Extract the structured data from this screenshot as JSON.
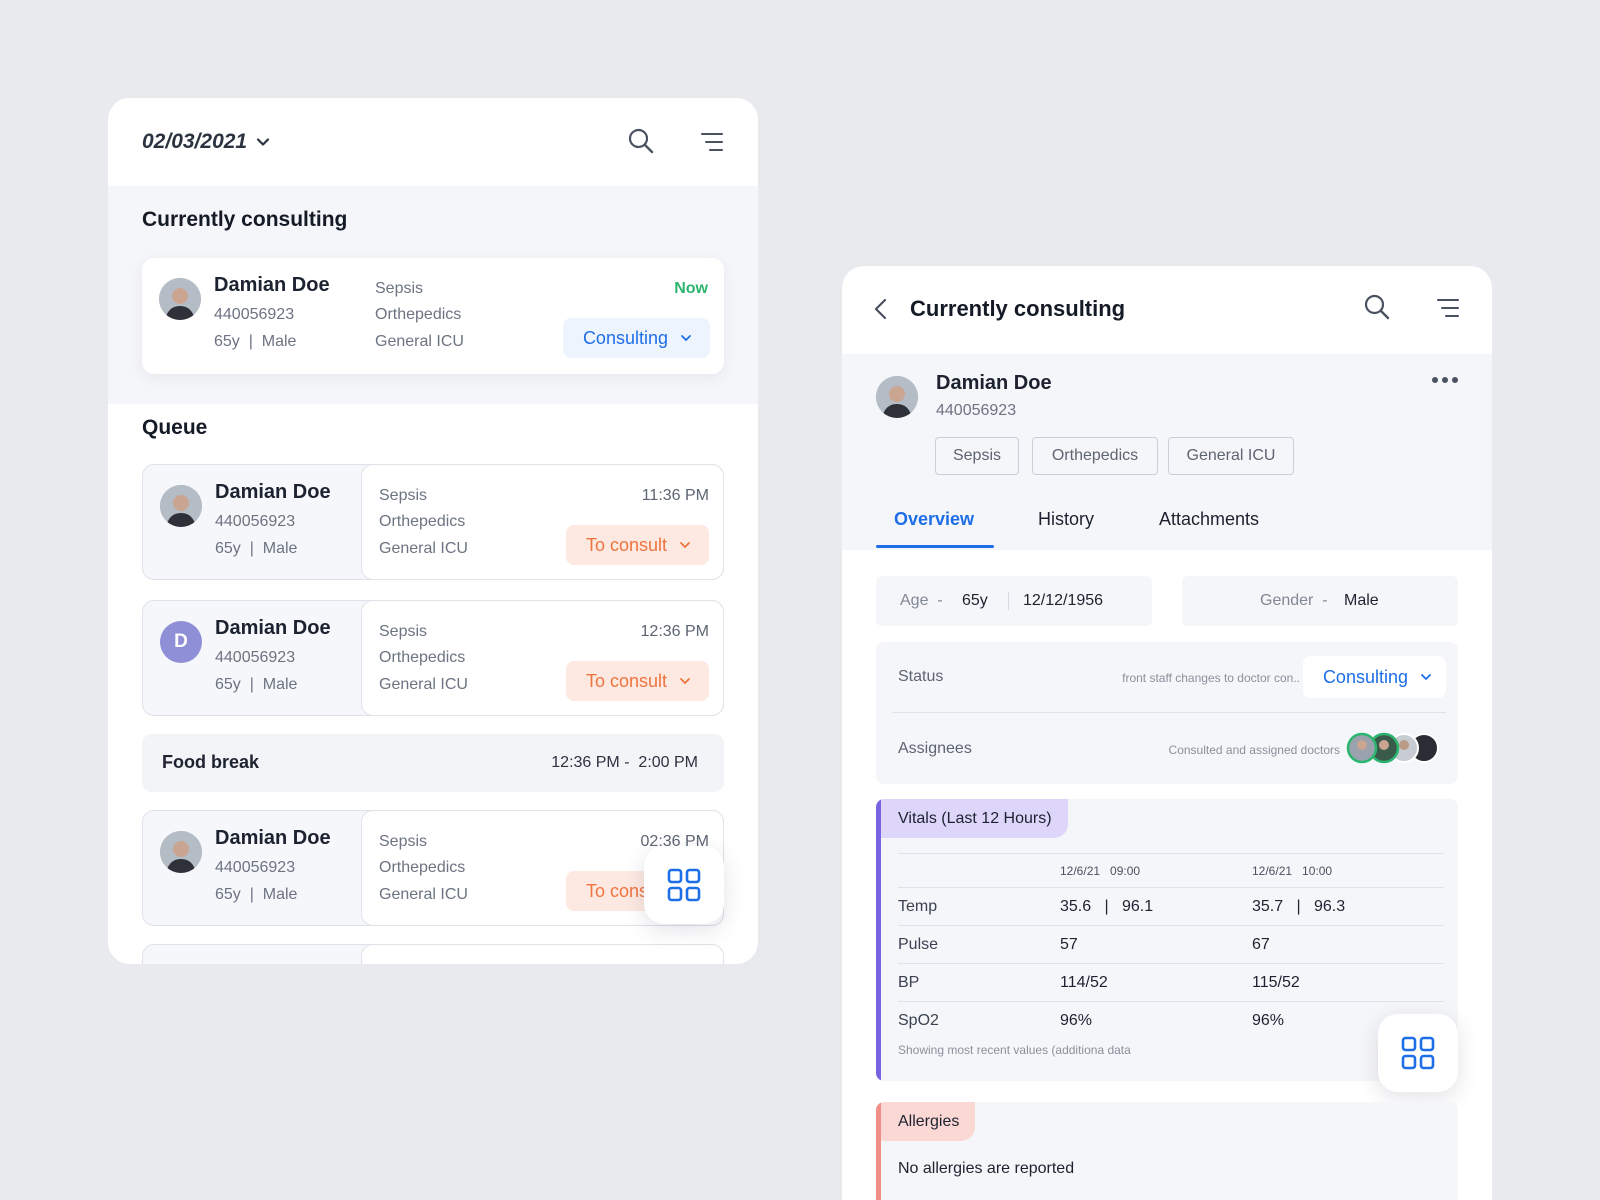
{
  "colors": {
    "accent": "#1e6ee8",
    "now": "#2bb56e",
    "to_consult": "#ee7440",
    "vitals_bar": "#7a63e0",
    "vitals_tag_bg": "#ddd6fa",
    "allergy_bar": "#ef8f88",
    "allergy_tag_bg": "#fbd8d4"
  },
  "left": {
    "date": "02/03/2021",
    "icons": [
      "search-icon",
      "menu-icon",
      "chevron-down-icon",
      "grid-icon"
    ],
    "current_title": "Currently consulting",
    "current": {
      "name": "Damian Doe",
      "id": "440056923",
      "info": "65y  |  Male",
      "depts": [
        "Sepsis",
        "Orthepedics",
        "General ICU"
      ],
      "time": "Now",
      "status": "Consulting"
    },
    "queue_title": "Queue",
    "queue": [
      {
        "name": "Damian Doe",
        "id": "440056923",
        "info": "65y  |  Male",
        "depts": [
          "Sepsis",
          "Orthepedics",
          "General ICU"
        ],
        "time": "11:36 PM",
        "status": "To consult",
        "avatar": "photo"
      },
      {
        "name": "Damian Doe",
        "id": "440056923",
        "info": "65y  |  Male",
        "depts": [
          "Sepsis",
          "Orthepedics",
          "General ICU"
        ],
        "time": "12:36 PM",
        "status": "To consult",
        "avatar": "D"
      },
      {
        "name": "Damian Doe",
        "id": "440056923",
        "info": "65y  |  Male",
        "depts": [
          "Sepsis",
          "Orthepedics",
          "General ICU"
        ],
        "time": "02:36 PM",
        "status": "To consult",
        "avatar": "photo"
      }
    ],
    "break": {
      "label": "Food break",
      "time": "12:36 PM -  2:00 PM"
    }
  },
  "right": {
    "title": "Currently consulting",
    "patient": {
      "name": "Damian Doe",
      "id": "440056923"
    },
    "tags": [
      "Sepsis",
      "Orthepedics",
      "General ICU"
    ],
    "tabs": [
      "Overview",
      "History",
      "Attachments"
    ],
    "active_tab": "Overview",
    "age_label": "Age  -",
    "age": "65y",
    "dob": "12/12/1956",
    "gender_label": "Gender  -",
    "gender": "Male",
    "status_label": "Status",
    "status_hint": "front staff changes to doctor con..",
    "status_value": "Consulting",
    "assignees_label": "Assignees",
    "assignees_hint": "Consulted and assigned doctors",
    "vitals": {
      "title": "Vitals (Last 12 Hours)",
      "columns": [
        "12/6/21   09:00",
        "12/6/21   10:00"
      ],
      "rows": [
        {
          "label": "Temp",
          "v1": "35.6   |   96.1",
          "v2": "35.7   |   96.3"
        },
        {
          "label": "Pulse",
          "v1": "57",
          "v2": "67"
        },
        {
          "label": "BP",
          "v1": "114/52",
          "v2": "115/52"
        },
        {
          "label": "SpO2",
          "v1": "96%",
          "v2": "96%"
        }
      ],
      "footer": "Showing most recent values (additiona data"
    },
    "allergies": {
      "title": "Allergies",
      "text": "No allergies are reported"
    }
  }
}
